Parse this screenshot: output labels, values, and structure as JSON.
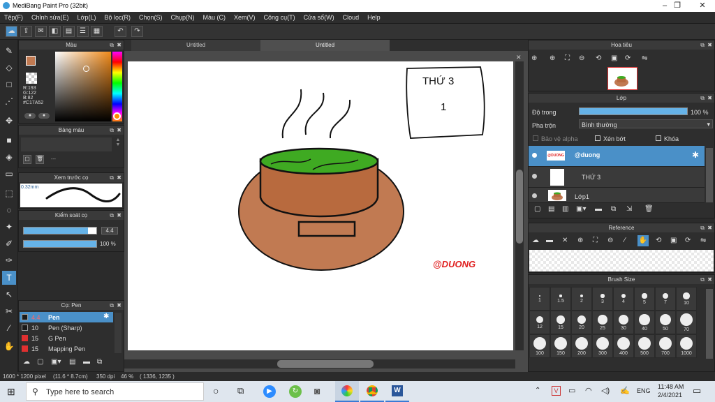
{
  "app": {
    "title": "MediBang Paint Pro (32bit)",
    "window_controls": {
      "minimize": "–",
      "restore": "❐",
      "close": "✕"
    }
  },
  "menu": [
    "Tệp(F)",
    "Chỉnh sửa(E)",
    "Lớp(L)",
    "Bộ lọc(R)",
    "Chọn(S)",
    "Chụp(N)",
    "Màu (C)",
    "Xem(V)",
    "Công cụ(T)",
    "Cửa sổ(W)",
    "Cloud",
    "Help"
  ],
  "color_panel": {
    "title": "Màu",
    "readout": {
      "r": "R:193",
      "g": "G:122",
      "b": "B:82",
      "hex": "#C17A52"
    },
    "primary_color": "#C17A52"
  },
  "palette_panel": {
    "title": "Bảng màu",
    "separator": "---"
  },
  "brush_preview_panel": {
    "title": "Xem trước cọ",
    "size": "0.32mm"
  },
  "brush_control_panel": {
    "title": "Kiểm soát cọ",
    "size_value": "4.4",
    "opacity_value": "100 %",
    "size_fraction": 0.88,
    "opacity_fraction": 1.0
  },
  "brush_list_panel": {
    "title": "Cọ: Pen",
    "brushes": [
      {
        "size": "4.4",
        "name": "Pen",
        "color": "#1a1a1a",
        "selected": true
      },
      {
        "size": "10",
        "name": "Pen (Sharp)",
        "color": "#1a1a1a",
        "selected": false
      },
      {
        "size": "15",
        "name": "G Pen",
        "color": "#e03030",
        "selected": false
      },
      {
        "size": "15",
        "name": "Mapping Pen",
        "color": "#e03030",
        "selected": false
      }
    ]
  },
  "canvas": {
    "tabs": [
      "Untitled",
      "Untitled"
    ],
    "drawing": {
      "box_title": "THỨ 3",
      "box_number": "1",
      "signature": "@DUONG"
    }
  },
  "navigator_panel": {
    "title": "Hoa tiêu"
  },
  "layer_panel": {
    "title": "Lớp",
    "opacity_label": "Độ trong",
    "opacity_value": "100 %",
    "opacity_fraction": 1.0,
    "blend_label": "Pha trộn",
    "blend_value": "Bình thường",
    "protect_alpha": "Bảo vệ alpha",
    "clipping": "Xén bớt",
    "lock": "Khóa",
    "layers": [
      {
        "name": "@duong",
        "selected": true
      },
      {
        "name": "THỨ 3",
        "selected": false
      },
      {
        "name": "Lớp1",
        "selected": false
      }
    ]
  },
  "reference_panel": {
    "title": "Reference"
  },
  "brush_size_panel": {
    "title": "Brush Size",
    "sizes": [
      "1",
      "1.5",
      "2",
      "3",
      "4",
      "5",
      "7",
      "10",
      "12",
      "15",
      "20",
      "25",
      "30",
      "40",
      "50",
      "70",
      "100",
      "150",
      "200",
      "300",
      "400",
      "500",
      "700",
      "1000"
    ]
  },
  "status": {
    "dimensions": "1600 * 1200 pixel",
    "physical": "(11.6 * 8.7cm)",
    "dpi": "350 dpi",
    "zoom": "46 %",
    "cursor": "( 1336, 1235 )"
  },
  "taskbar": {
    "search_placeholder": "Type here to search",
    "language": "ENG",
    "time": "11:48 AM",
    "date": "2/4/2021"
  }
}
